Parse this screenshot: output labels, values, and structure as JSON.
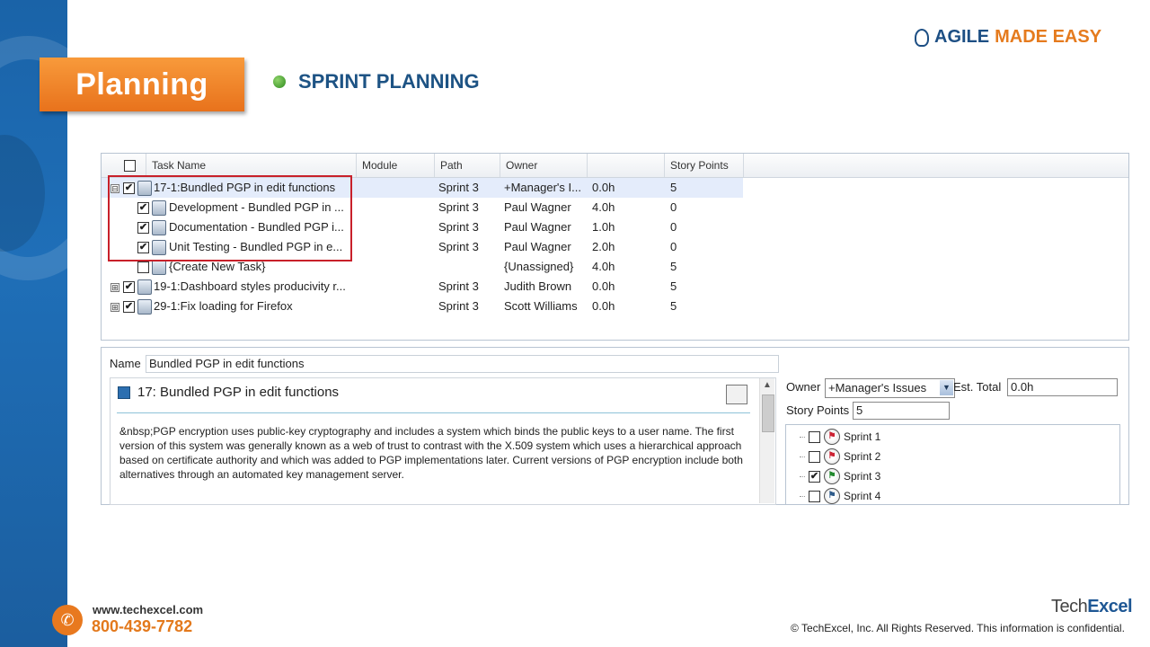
{
  "brand": {
    "word1": "AGILE",
    "word2": "MADE EASY"
  },
  "badge": "Planning",
  "heading": "SPRINT PLANNING",
  "grid": {
    "columns": [
      "Task Name",
      "Module",
      "Path",
      "Owner",
      "",
      "Story Points"
    ],
    "rows": [
      {
        "task": "17-1:Bundled PGP in edit functions",
        "module": "",
        "path": "Sprint 3",
        "owner": "+Manager's I...",
        "est": "0.0h",
        "points": "5",
        "checked": true,
        "level": 0,
        "expander": "⊟"
      },
      {
        "task": "Development - Bundled PGP in ...",
        "module": "",
        "path": "Sprint 3",
        "owner": "Paul Wagner",
        "est": "4.0h",
        "points": "0",
        "checked": true,
        "level": 1,
        "expander": ""
      },
      {
        "task": "Documentation - Bundled PGP i...",
        "module": "",
        "path": "Sprint 3",
        "owner": "Paul Wagner",
        "est": "1.0h",
        "points": "0",
        "checked": true,
        "level": 1,
        "expander": ""
      },
      {
        "task": "Unit Testing - Bundled PGP in e...",
        "module": "",
        "path": "Sprint 3",
        "owner": "Paul Wagner",
        "est": "2.0h",
        "points": "0",
        "checked": true,
        "level": 1,
        "expander": ""
      },
      {
        "task": "{Create New Task}",
        "module": "",
        "path": "",
        "owner": "{Unassigned}",
        "est": "4.0h",
        "points": "5",
        "checked": false,
        "level": 1,
        "expander": ""
      },
      {
        "task": "19-1:Dashboard styles producivity r...",
        "module": "",
        "path": "Sprint 3",
        "owner": "Judith Brown",
        "est": "0.0h",
        "points": "5",
        "checked": true,
        "level": 0,
        "expander": "⊞"
      },
      {
        "task": "29-1:Fix loading for Firefox",
        "module": "",
        "path": "Sprint 3",
        "owner": "Scott Williams",
        "est": "0.0h",
        "points": "5",
        "checked": true,
        "level": 0,
        "expander": "⊞"
      }
    ]
  },
  "detail": {
    "name_label": "Name",
    "name_value": "Bundled PGP in edit functions",
    "title": "17: Bundled PGP in edit functions",
    "description": "&nbsp;PGP encryption uses public-key cryptography and includes a system which binds the public keys to a user name. The first version of this system was generally known as a web of trust to contrast with the X.509 system which uses a hierarchical approach based on certificate authority and which was added to PGP implementations later. Current versions of PGP encryption include both alternatives through an automated key management server.",
    "owner_label": "Owner",
    "owner_value": "+Manager's Issues",
    "est_label": "Est. Total",
    "est_value": "0.0h",
    "points_label": "Story Points",
    "points_value": "5",
    "sprints": [
      {
        "label": "Sprint 1",
        "checked": false,
        "state": "red"
      },
      {
        "label": "Sprint 2",
        "checked": false,
        "state": "red"
      },
      {
        "label": "Sprint 3",
        "checked": true,
        "state": "green"
      },
      {
        "label": "Sprint 4",
        "checked": false,
        "state": "blue"
      }
    ]
  },
  "footer": {
    "url": "www.techexcel.com",
    "phone": "800-439-7782",
    "logo_a": "Tech",
    "logo_b": "Excel",
    "copyright": "© TechExcel, Inc.  All Rights Reserved.  This information is confidential."
  }
}
